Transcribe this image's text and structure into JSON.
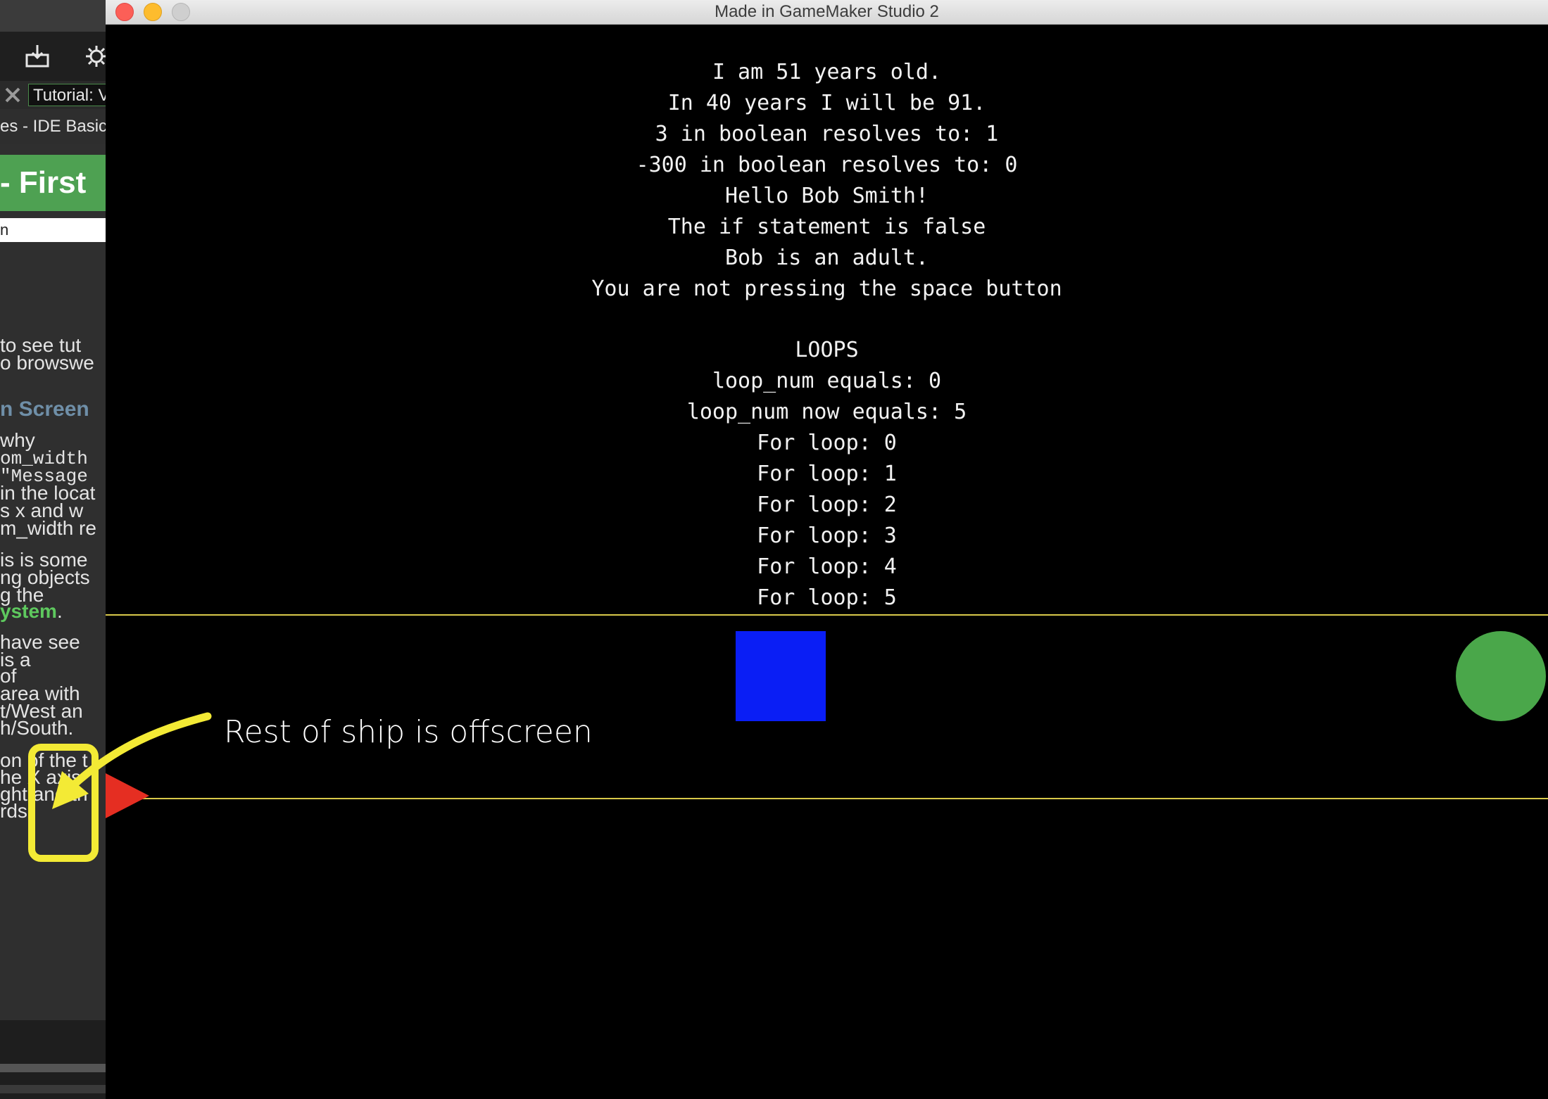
{
  "window": {
    "title": "Made in GameMaker Studio 2"
  },
  "ide": {
    "tab_label": "Tutorial: V",
    "breadcrumb": "es - IDE Basics",
    "doc_header": "- First",
    "search_value": "n",
    "doc_lines": [
      "to  see  tut",
      "o  browswe",
      "n Screen",
      " why",
      "om_width",
      "  \"Message",
      "in the locat",
      "s  x  and  w",
      "m_width re",
      "is is some",
      "ng  objects",
      "g    the",
      "ystem",
      " have  see",
      "  is    a",
      "          of",
      "area   with",
      "t/West  an",
      "h/South.",
      "on  of the t",
      "he  X  axis",
      "ght and th",
      "rds."
    ]
  },
  "console": {
    "lines": [
      "I am 51 years old.",
      "In 40 years I will be 91.",
      "3 in boolean resolves to: 1",
      "-300 in boolean resolves to: 0",
      "Hello Bob Smith!",
      "The if statement is false",
      "Bob is an adult.",
      "You are not pressing the space button",
      "",
      "LOOPS",
      "loop_num equals: 0",
      "loop_num now equals: 5",
      "For loop: 0",
      "For loop: 1",
      "For loop: 2",
      "For loop: 3",
      "For loop: 4",
      "For loop: 5"
    ]
  },
  "game_objects": {
    "blue_square_color": "#0a1ef5",
    "green_circle_color": "#4aa74a",
    "ship_color": "#e52e22",
    "boundary_color": "#d9c94a"
  },
  "annotation": {
    "label": "Rest of ship is offscreen",
    "color": "#f3ea35"
  },
  "traffic_lights": {
    "close": "#fc5f57",
    "minimize": "#fdbc2e",
    "zoom": "#c9c9c9"
  }
}
